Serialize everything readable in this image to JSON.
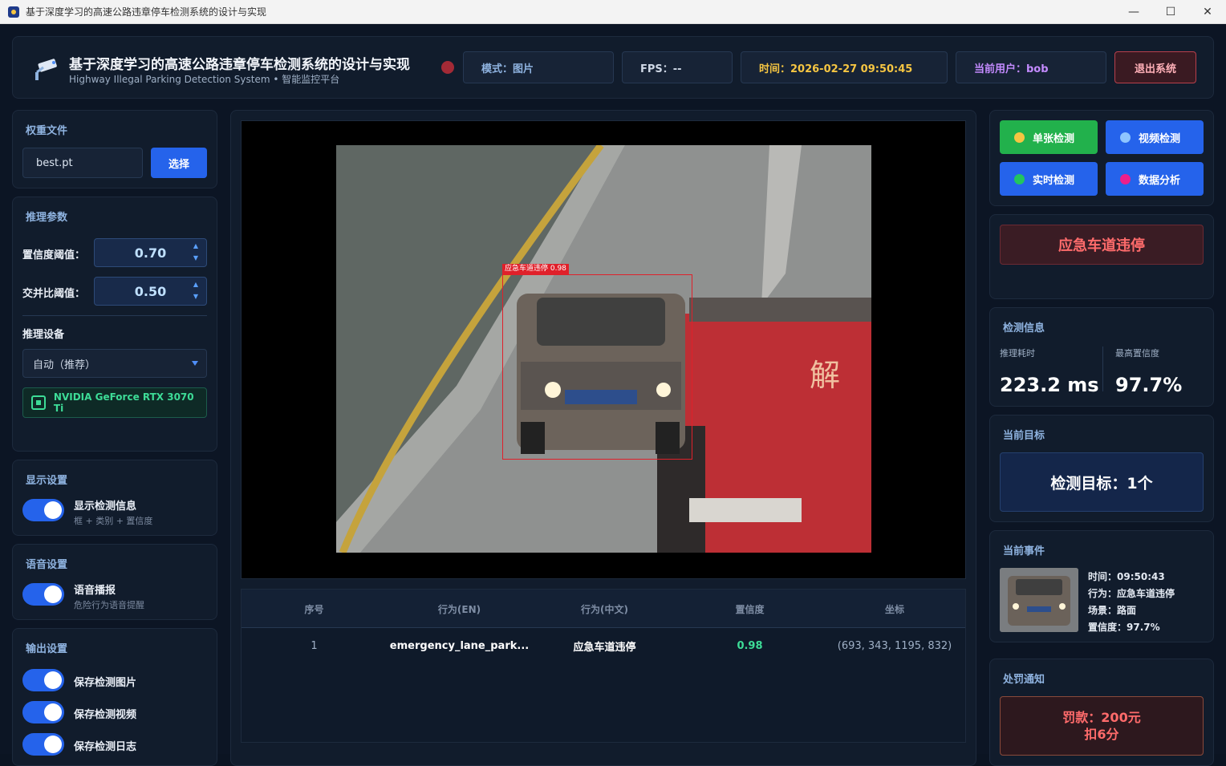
{
  "window": {
    "title": "基于深度学习的高速公路违章停车检测系统的设计与实现"
  },
  "header": {
    "title": "基于深度学习的高速公路违章停车检测系统的设计与实现",
    "subtitle": "Highway Illegal Parking Detection System • 智能监控平台",
    "mode": "模式：图片",
    "fps": "FPS：--",
    "time": "时间：2026-02-27 09:50:45",
    "user": "当前用户：bob",
    "logout": "退出系统"
  },
  "weights": {
    "title": "权重文件",
    "value": "best.pt",
    "choose": "选择"
  },
  "inference": {
    "title": "推理参数",
    "conf_label": "置信度阈值：",
    "conf_value": "0.70",
    "iou_label": "交并比阈值：",
    "iou_value": "0.50",
    "device_label": "推理设备",
    "device_value": "自动（推荐）",
    "gpu": "NVIDIA GeForce RTX 3070 Ti"
  },
  "display": {
    "title": "显示设置",
    "toggle_label": "显示检测信息",
    "toggle_sub": "框 + 类别 + 置信度"
  },
  "voice": {
    "title": "语音设置",
    "toggle_label": "语音播报",
    "toggle_sub": "危险行为语音提醒"
  },
  "output": {
    "title": "输出设置",
    "items": [
      "保存检测图片",
      "保存检测视频",
      "保存检测日志"
    ]
  },
  "detection_overlay": {
    "label": "应急车道违停 0.98"
  },
  "table": {
    "headers": [
      "序号",
      "行为(EN)",
      "行为(中文)",
      "置信度",
      "坐标"
    ],
    "rows": [
      {
        "index": "1",
        "en": "emergency_lane_park...",
        "cn": "应急车道违停",
        "conf": "0.98",
        "coords": "(693, 343, 1195, 832)"
      }
    ]
  },
  "modes": {
    "single": "单张检测",
    "video": "视频检测",
    "realtime": "实时检测",
    "analysis": "数据分析"
  },
  "alert": "应急车道违停",
  "info": {
    "title": "检测信息",
    "time_label": "推理耗时",
    "time_value": "223.2 ms",
    "conf_label": "最高置信度",
    "conf_value": "97.7%"
  },
  "target": {
    "title": "当前目标",
    "text": "检测目标：1个"
  },
  "event": {
    "title": "当前事件",
    "time": "时间：09:50:43",
    "behavior": "行为：应急车道违停",
    "scene": "场景：路面",
    "conf": "置信度：97.7%"
  },
  "penalty": {
    "title": "处罚通知",
    "line1": "罚款：200元",
    "line2": "扣6分"
  },
  "colors": {
    "accent": "#2563eb",
    "green": "#22c55e",
    "alert": "#ff6b6b",
    "detect": "#e0202a"
  }
}
